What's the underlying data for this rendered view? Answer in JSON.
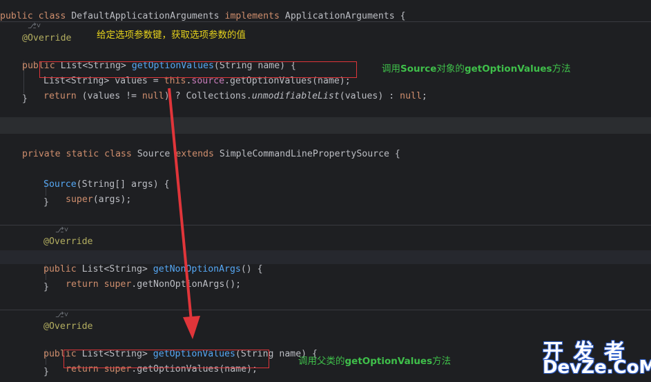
{
  "code": {
    "line_class_decl": [
      "public class ",
      "DefaultApplicationArguments",
      " implements ",
      "ApplicationArguments",
      " {"
    ],
    "hint_1": "⎇˅",
    "override_1": "@Override",
    "method1_sig": [
      "public ",
      "List<String> ",
      "getOptionValues",
      "(String name) {"
    ],
    "method1_body1": [
      "List<String> values = ",
      "this",
      ".",
      "source",
      ".getOptionValues(name);"
    ],
    "method1_body2": [
      "return ",
      "(values != ",
      "null",
      ") ? Collections.",
      "unmodifiableList",
      "(values) : ",
      "null",
      ";"
    ],
    "close_1": "}",
    "inner_class_decl": [
      "private static class ",
      "Source ",
      "extends ",
      "SimpleCommandLinePropertySource {"
    ],
    "ctor_sig": [
      "Source",
      "(String[] args) {"
    ],
    "ctor_body": [
      "super",
      "(args);"
    ],
    "close_2": "}",
    "hint_2": "⎇˅",
    "override_2": "@Override",
    "method2_sig": [
      "public ",
      "List<String> ",
      "getNonOptionArgs",
      "() {"
    ],
    "method2_body": [
      "return ",
      "super",
      ".getNonOptionArgs();"
    ],
    "close_3": "}",
    "hint_3": "⎇˅",
    "override_3": "@Override",
    "method3_sig": [
      "public ",
      "List<String> ",
      "getOptionValues",
      "(String name) {"
    ],
    "method3_body": [
      "return ",
      "super",
      ".getOptionValues(name);"
    ],
    "close_4": "}"
  },
  "annotations": {
    "note_top": "给定选项参数键，获取选项参数的值",
    "note_source_prefix": "调用",
    "note_source_bold1": "Source",
    "note_source_mid": "对象的",
    "note_source_bold2": "getOptionValues",
    "note_source_suffix": "方法",
    "note_parent_prefix": "调用父类的",
    "note_parent_bold": "getOptionValues",
    "note_parent_suffix": "方法"
  },
  "watermark": {
    "top": "开 发 者",
    "bottom": "DevZe.CoM"
  },
  "colors": {
    "background": "#1e1f22",
    "keyword": "#cf8e6d",
    "method": "#56a8f5",
    "annotation": "#b3ae60",
    "field": "#c77dbb",
    "note_yellow": "#e6d21c",
    "note_green": "#3fbf4a",
    "arrow_red": "#e0353a"
  }
}
